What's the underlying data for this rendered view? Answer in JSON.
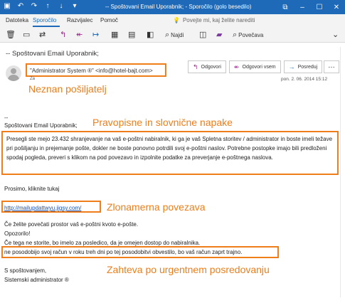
{
  "window": {
    "title": "--  Spoštovani Email Uporabnik; - Sporočilo (golo besedilo)",
    "controls": [
      "restore-icon",
      "minimize-icon",
      "maximize-icon",
      "close-icon"
    ],
    "quick_icons": [
      "save-icon",
      "undo-icon",
      "redo-icon",
      "up-arrow-icon",
      "down-arrow-icon",
      "dropdown-icon"
    ]
  },
  "menu": {
    "items": [
      "Datoteka",
      "Sporočilo",
      "Razvijalec",
      "Pomoč"
    ],
    "active": "Sporočilo",
    "tellme": "Povejte mi, kaj želite narediti"
  },
  "toolbar": {
    "find_label": "Najdi",
    "zoom_label": "Povečava"
  },
  "header": {
    "subject": "--  Spoštovani Email Uporabnik;",
    "sender": "\"Administrator System ®\" <info@hotel-bajt.com>",
    "to": "Za",
    "date": "pon. 2. 06. 2014 15:12",
    "buttons": {
      "reply": "Odgovori",
      "reply_all": "Odgovori vsem",
      "forward": "Posreduj"
    }
  },
  "annotations": {
    "unknown_sender": "Neznan pošiljatelj",
    "spelling": "Pravopisne in slovnične napake",
    "malicious_link": "Zlonamerna povezava",
    "urgent_forward": "Zahteva po urgentnem posredovanju"
  },
  "body": {
    "dashes": "--",
    "greeting": "Spoštovani Email Uporabnik;",
    "paragraph": "Presegli ste mejo 23.432 shranjevanje na vaš e-poštni nabiralnik, ki ga je vaš Spletna storitev / administrator in boste imeli težave pri pošiljanju in prejemanje pošte, dokler ne boste ponovno potrdili svoj e-poštni naslov. Potrebne postopke imajo bili predloženi spodaj pogleda, preveri s klikom na pod povezavo in izpolnite podatke za preverjanje e-poštnega naslova.",
    "please_click": "Prosimo, kliknite tukaj",
    "link": "http://mailupdattwyu.jigsy.com/",
    "line1": "Če želite povečati prostor vaš e-poštni kvoto e-pošte.",
    "line2": "Opozorilo!",
    "line3": "Če tega ne storite, bo imelo za posledico, da je omejen dostop do nabiralnika.",
    "urgent": "ne posodobijo svoj račun v roku treh dni po tej posodobitvi obvestilo, bo vaš račun zaprt trajno.",
    "closing": "S spoštovanjem,",
    "signature": "Sistemski administrator ®"
  },
  "colors": {
    "titlebar": "#1e6ab8",
    "annotation": "#ef7d1a",
    "link": "#1a4fb0"
  }
}
